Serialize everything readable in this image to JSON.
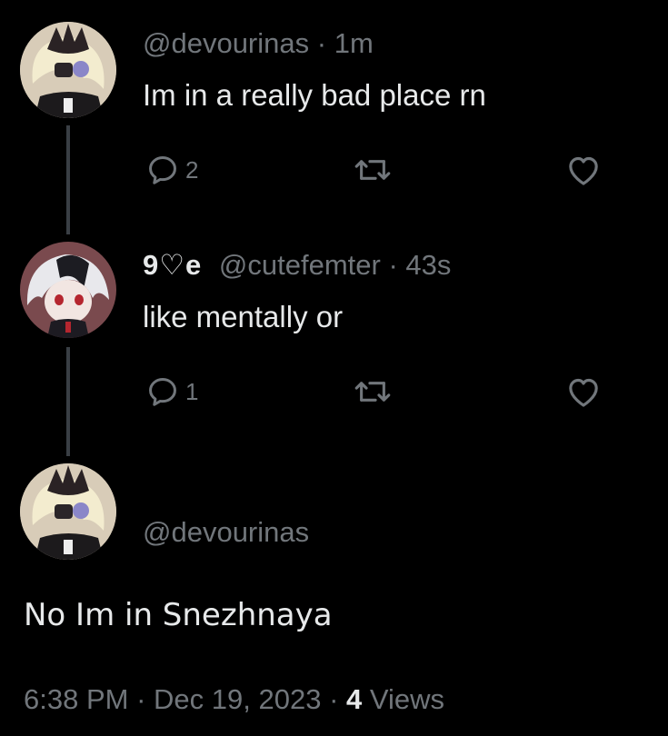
{
  "tweets": [
    {
      "handle": "@devourinas",
      "sep": "·",
      "time": "1m",
      "text": "Im in a really bad place rn",
      "reply_count": "2"
    },
    {
      "display_name": "9♡e",
      "handle": "@cutefemter",
      "sep": "·",
      "time": "43s",
      "text": "like mentally or",
      "reply_count": "1"
    }
  ],
  "main_tweet": {
    "handle": "@devourinas",
    "text": "No Im in Snezhnaya",
    "time": "6:38 PM",
    "date": "Dec 19, 2023",
    "sep": "·",
    "views_count": "4",
    "views_label": "Views"
  },
  "icons": {
    "reply": "reply-icon",
    "retweet": "retweet-icon",
    "like": "heart-icon"
  },
  "colors": {
    "background": "#000000",
    "text": "#e7e9ea",
    "muted": "#71767b",
    "thread_line": "#3a3f45"
  }
}
